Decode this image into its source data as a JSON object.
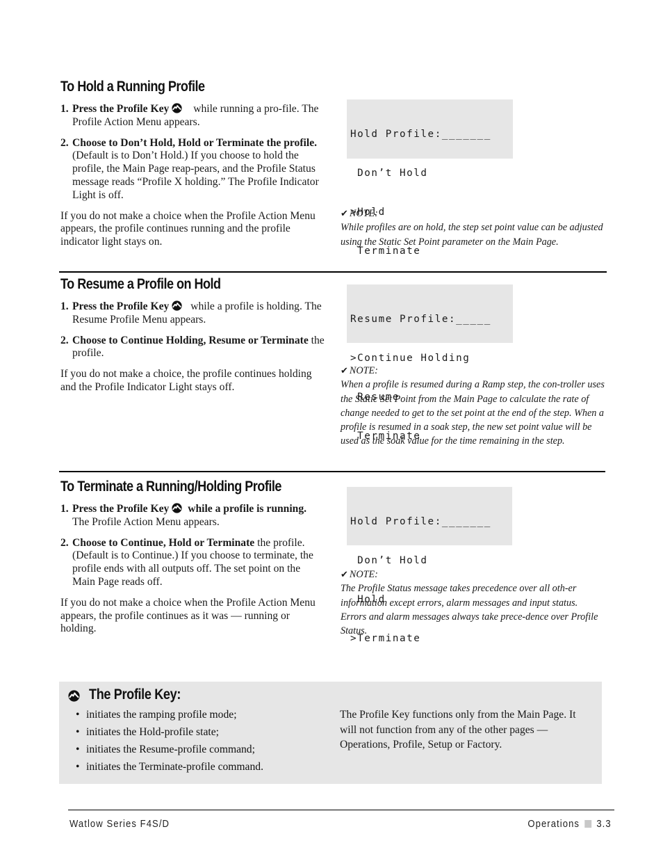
{
  "sections": [
    {
      "title": "To Hold a Running Profile",
      "steps": [
        {
          "num": "1.",
          "bold": "Press the Profile Key",
          "after_icon_bold": "",
          "text": " while running a pro-file. The Profile Action Menu appears."
        },
        {
          "num": "2.",
          "bold": "Choose to Don’t Hold, Hold or Terminate the profile.",
          "text": " (Default is to Don’t Hold.) If you choose to hold the profile, the Main Page reap-pears, and the Profile Status message reads “Profile X holding.” The Profile Indicator Light is off."
        }
      ],
      "paragraph": "If you do not make a choice when the Profile  Action Menu appears, the profile continues running and the profile indicator light stays on.",
      "lcd": [
        "Hold Profile:_______",
        " Don’t Hold",
        ">Hold",
        " Terminate"
      ],
      "note_label": "NOTE:",
      "note": "While profiles are on hold, the step set point value can be adjusted using the Static Set Point parameter on the Main Page."
    },
    {
      "title": "To Resume a Profile on Hold",
      "steps": [
        {
          "num": "1.",
          "bold": "Press the Profile Key",
          "after_icon_bold": "",
          "text": " while a profile is holding. The Resume Profile Menu appears."
        },
        {
          "num": "2.",
          "bold": "Choose to Continue Holding, Resume or Terminate",
          "text": " the profile."
        }
      ],
      "paragraph": "If you do not make a choice, the profile continues holding and the Profile Indicator Light stays off.",
      "lcd": [
        "Resume Profile:_____",
        ">Continue Holding",
        " Resume",
        " Terminate"
      ],
      "note_label": "NOTE:",
      "note": "When a profile is resumed during a Ramp step, the con-troller uses the Static Set Point from the Main Page to calculate the rate of change needed to get to the set point at the end of the step.  When a profile is resumed in a soak step, the new set point value will be used as the soak value for the time remaining in the step."
    },
    {
      "title": "To Terminate a Running/Holding Profile",
      "steps": [
        {
          "num": "1.",
          "bold": "Press the Profile Key",
          "after_icon_bold": " while a profile is running.",
          "text": " The Profile Action Menu appears."
        },
        {
          "num": "2.",
          "bold": "Choose to Continue, Hold or Terminate",
          "text": " the profile. (Default is to Continue.) If you choose to terminate, the profile ends with all outputs off. The set point on the Main Page reads off."
        }
      ],
      "paragraph": "If you do not make a choice when the Profile  Action Menu appears, the profile continues as it was — running or holding.",
      "lcd": [
        "Hold Profile:_______",
        " Don’t Hold",
        " Hold",
        ">Terminate"
      ],
      "note_label": "NOTE:",
      "note": "The Profile Status message takes precedence over all oth-er information except errors, alarm messages and input status. Errors and alarm messages always take prece-dence over Profile Status."
    }
  ],
  "profile_key_box": {
    "icon": "profile-key-icon",
    "title": "The Profile Key:",
    "bullets": [
      "initiates the ramping profile mode;",
      "initiates the Hold-profile state;",
      "initiates the Resume-profile command;",
      "initiates the Terminate-profile command."
    ],
    "description": "The Profile Key functions only from the Main Page. It will not function from any of the other pages — Operations, Profile, Setup or Factory."
  },
  "footer": {
    "left": "Watlow Series F4S/D",
    "section": "Operations",
    "page": "3.3"
  },
  "colors": {
    "shade": "#e6e6e6",
    "footer_square": "#c8c8c8"
  }
}
